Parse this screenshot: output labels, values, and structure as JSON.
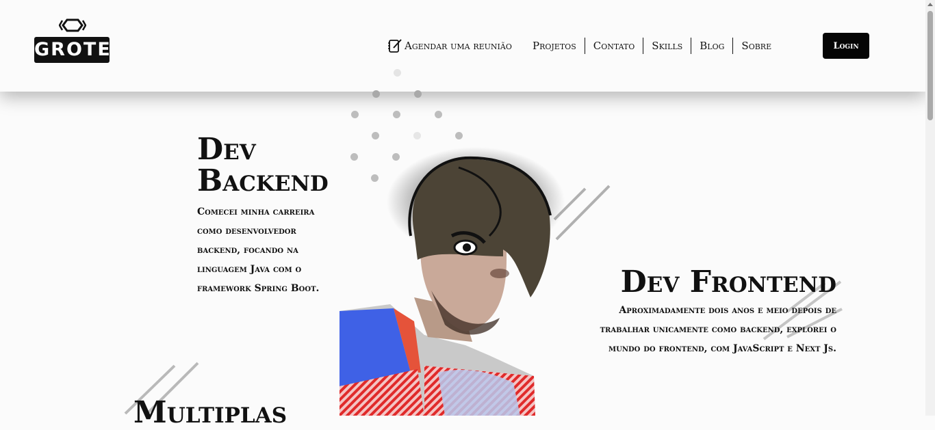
{
  "header": {
    "logo_text": "GROTE",
    "meeting_label": "Agendar uma reunião",
    "nav": [
      {
        "label": "Projetos"
      },
      {
        "label": "Contato"
      },
      {
        "label": "Skills"
      },
      {
        "label": "Blog"
      },
      {
        "label": "Sobre"
      }
    ],
    "login_label": "Login"
  },
  "sections": {
    "backend": {
      "title_line1": "Dev",
      "title_line2": "Backend",
      "text": "Comecei minha carreira como desenvolvedor backend, focando na linguagem Java com o framework Spring Boot."
    },
    "frontend": {
      "title": "Dev Frontend",
      "text": "Aproximadamente dois anos e meio depois de trabalhar unicamente como backend, explorei o mundo do frontend, com JavaScript e Next Js."
    },
    "multi": {
      "title": "Multiplas"
    }
  },
  "icons": {
    "logo_mark": "hexagon-brackets-icon",
    "meeting": "notebook-pen-icon"
  },
  "colors": {
    "accent": "#050505",
    "background": "#fbfbfb"
  }
}
